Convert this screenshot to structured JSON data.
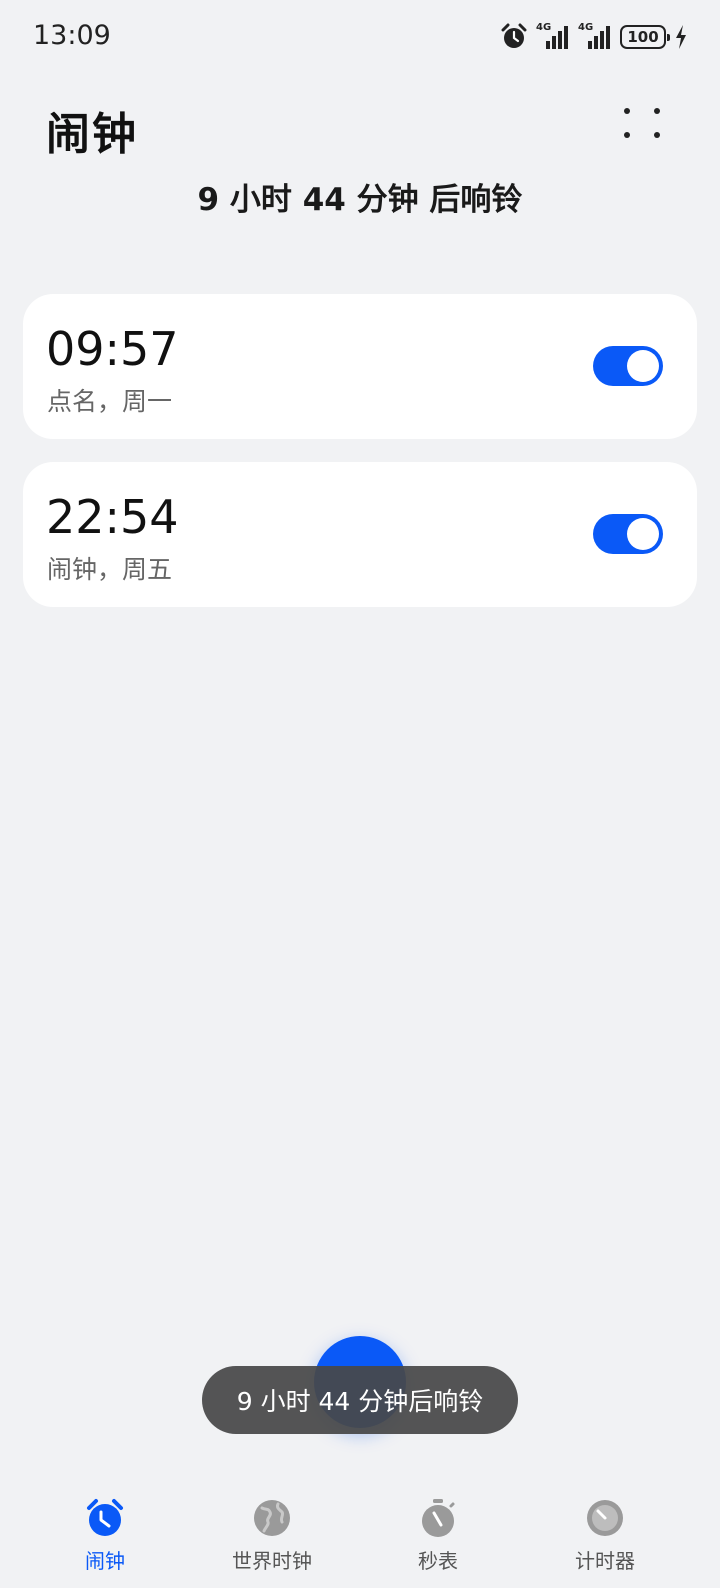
{
  "status_bar": {
    "time": "13:09",
    "signal1_label": "4G",
    "signal2_label": "4G",
    "battery": "100",
    "icons": [
      "alarm-icon",
      "signal-icon",
      "signal-icon",
      "battery-icon",
      "charging-icon"
    ]
  },
  "header": {
    "title": "闹钟",
    "more_icon": "more-dots-icon"
  },
  "next_ring": "9 小时 44 分钟 后响铃",
  "alarms": [
    {
      "time": "09:57",
      "desc": "点名，周一",
      "enabled": true
    },
    {
      "time": "22:54",
      "desc": "闹钟，周五",
      "enabled": true
    }
  ],
  "toast": "9 小时 44 分钟后响铃",
  "nav": [
    {
      "label": "闹钟",
      "icon": "alarm-clock-icon",
      "active": true
    },
    {
      "label": "世界时钟",
      "icon": "globe-icon",
      "active": false
    },
    {
      "label": "秒表",
      "icon": "stopwatch-icon",
      "active": false
    },
    {
      "label": "计时器",
      "icon": "timer-icon",
      "active": false
    }
  ],
  "colors": {
    "accent": "#0a59f7",
    "background": "#f1f2f4",
    "card": "#ffffff",
    "inactive_icon": "#9a9a9a"
  }
}
